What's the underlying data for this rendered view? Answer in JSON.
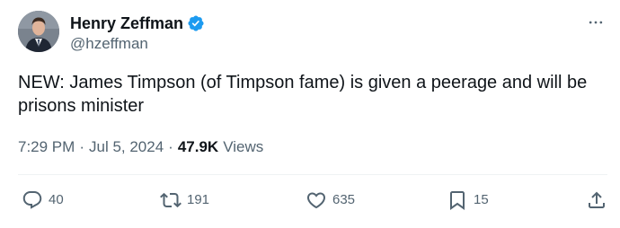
{
  "author": {
    "display_name": "Henry Zeffman",
    "handle": "@hzeffman",
    "verified": true
  },
  "icons": {
    "avatar": "profile-photo",
    "verified": "verified-badge-icon",
    "more": "more-icon",
    "reply": "reply-icon",
    "repost": "repost-icon",
    "like": "like-icon",
    "bookmark": "bookmark-icon",
    "share": "share-icon"
  },
  "tweet": {
    "text": "NEW: James Timpson (of Timpson fame) is given a peerage and will be prisons minister"
  },
  "meta": {
    "time": "7:29 PM",
    "separator": "·",
    "date": "Jul 5, 2024",
    "views_count": "47.9K",
    "views_label": "Views"
  },
  "actions": {
    "replies": "40",
    "reposts": "191",
    "likes": "635",
    "bookmarks": "15"
  },
  "colors": {
    "text_primary": "#0f1419",
    "text_secondary": "#536471",
    "verified_blue": "#1d9bf0",
    "divider": "#eff3f4"
  }
}
